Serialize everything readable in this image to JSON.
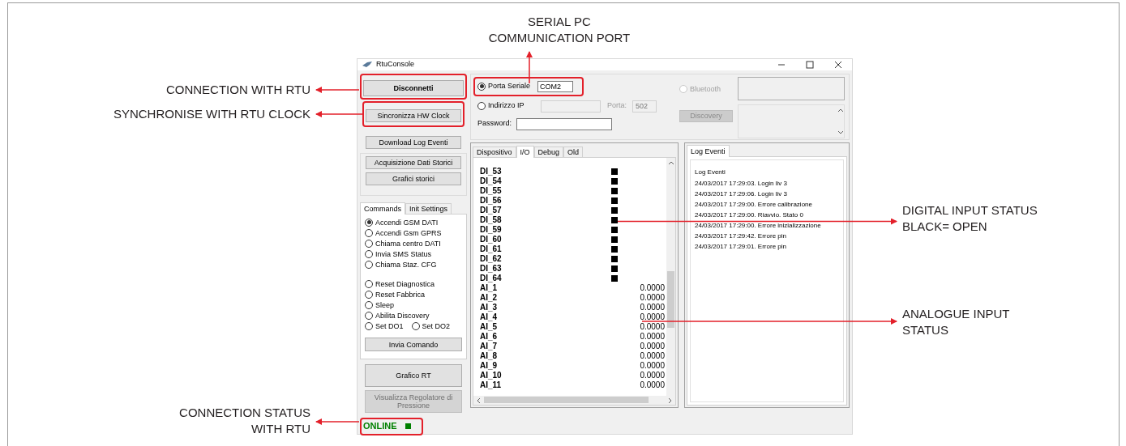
{
  "annotations": [
    {
      "kind": "left",
      "text": "CONNECTION WITH RTU"
    },
    {
      "kind": "left",
      "text": "SYNCHRONISE WITH RTU CLOCK"
    },
    {
      "kind": "left",
      "text": "CONNECTION STATUS\nWITH RTU"
    },
    {
      "kind": "top",
      "text": "SERIAL PC\nCOMMUNICATION PORT"
    },
    {
      "kind": "right",
      "text": "DIGITAL INPUT STATUS\nBLACK= OPEN"
    },
    {
      "kind": "right",
      "text": "ANALOGUE INPUT\nSTATUS"
    }
  ],
  "window": {
    "title": "RtuConsole"
  },
  "left_buttons": [
    {
      "label": "Disconnetti",
      "disabled": false
    },
    {
      "label": "Sincronizza HW Clock",
      "disabled": false
    },
    {
      "label": "Download Log Eventi",
      "disabled": false
    },
    {
      "label": "Acquisizione Dati Storici",
      "disabled": false
    },
    {
      "label": "Grafici storici",
      "disabled": false
    }
  ],
  "command_tabs": [
    {
      "label": "Commands",
      "selected": true
    },
    {
      "label": "Init Settings",
      "selected": false
    }
  ],
  "command_groups": [
    [
      [
        {
          "label": "Accendi GSM DATI",
          "selected": true
        }
      ],
      [
        {
          "label": "Accendi Gsm GPRS",
          "selected": false
        }
      ],
      [
        {
          "label": "Chiama centro DATI",
          "selected": false
        }
      ],
      [
        {
          "label": "Invia SMS Status",
          "selected": false
        }
      ],
      [
        {
          "label": "Chiama Staz. CFG",
          "selected": false
        }
      ]
    ],
    [
      [
        {
          "label": "Reset Diagnostica",
          "selected": false
        }
      ],
      [
        {
          "label": "Reset Fabbrica",
          "selected": false
        }
      ],
      [
        {
          "label": "Sleep",
          "selected": false
        }
      ],
      [
        {
          "label": "Abilita Discovery",
          "selected": false
        }
      ],
      [
        {
          "label": "Set DO1",
          "selected": false
        },
        {
          "label": "Set DO2",
          "selected": false
        }
      ]
    ]
  ],
  "send_button": {
    "label": "Invia Comando"
  },
  "bottom_buttons": [
    {
      "label": "Grafico RT",
      "disabled": false
    },
    {
      "label": "Visualizza Regolatore di Pressione",
      "disabled": true
    }
  ],
  "status": {
    "text": "ONLINE",
    "color": "#008000"
  },
  "connection": {
    "serial": {
      "label": "Porta Seriale",
      "selected": true,
      "value": "COM2"
    },
    "ip": {
      "label": "Indirizzo IP",
      "selected": false,
      "disabled": true,
      "port_label": "Porta:",
      "port_value": "502"
    },
    "bluetooth": {
      "label": "Bluetooth",
      "selected": false,
      "disabled": true
    },
    "discovery": {
      "label": "Discovery",
      "disabled": true
    },
    "password": {
      "label": "Password:"
    }
  },
  "io_tabs": [
    {
      "label": "Dispositivo",
      "selected": false
    },
    {
      "label": "I/O",
      "selected": true
    },
    {
      "label": "Debug",
      "selected": false
    },
    {
      "label": "Old",
      "selected": false
    }
  ],
  "digital_inputs": [
    {
      "name": "DI_53",
      "open": true
    },
    {
      "name": "DI_54",
      "open": true
    },
    {
      "name": "DI_55",
      "open": true
    },
    {
      "name": "DI_56",
      "open": true
    },
    {
      "name": "DI_57",
      "open": true
    },
    {
      "name": "DI_58",
      "open": true
    },
    {
      "name": "DI_59",
      "open": true
    },
    {
      "name": "DI_60",
      "open": true
    },
    {
      "name": "DI_61",
      "open": true
    },
    {
      "name": "DI_62",
      "open": true
    },
    {
      "name": "DI_63",
      "open": true
    },
    {
      "name": "DI_64",
      "open": true
    }
  ],
  "analog_inputs": [
    {
      "name": "AI_1",
      "value": "0.0000"
    },
    {
      "name": "AI_2",
      "value": "0.0000"
    },
    {
      "name": "AI_3",
      "value": "0.0000"
    },
    {
      "name": "AI_4",
      "value": "0.0000"
    },
    {
      "name": "AI_5",
      "value": "0.0000"
    },
    {
      "name": "AI_6",
      "value": "0.0000"
    },
    {
      "name": "AI_7",
      "value": "0.0000"
    },
    {
      "name": "AI_8",
      "value": "0.0000"
    },
    {
      "name": "AI_9",
      "value": "0.0000"
    },
    {
      "name": "AI_10",
      "value": "0.0000"
    },
    {
      "name": "AI_11",
      "value": "0.0000"
    }
  ],
  "log": {
    "tab": "Log Eventi",
    "header": "Log Eventi",
    "entries": [
      "24/03/2017 17:29:03. Login liv 3",
      "24/03/2017 17:29:06. Login liv 3",
      "24/03/2017 17:29:00. Errore calibrazione",
      "24/03/2017 17:29:00. Riavvio. Stato 0",
      "24/03/2017 17:29:00. Errore inizializzazione",
      "24/03/2017 17:29:42. Errore pin",
      "24/03/2017 17:29:01. Errore pin"
    ]
  }
}
